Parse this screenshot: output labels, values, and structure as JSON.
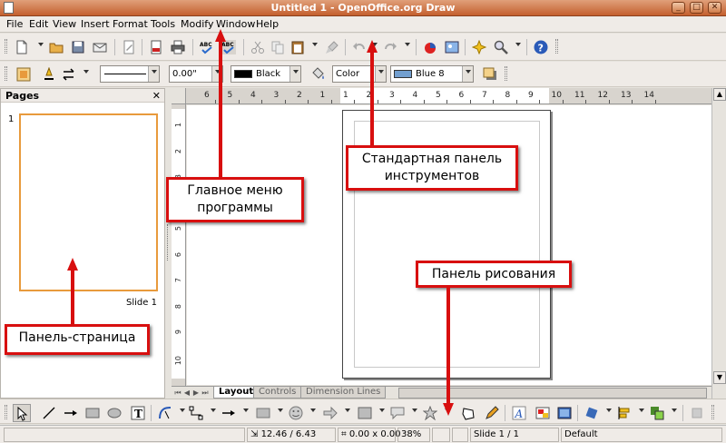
{
  "window": {
    "title": "Untitled 1 - OpenOffice.org Draw"
  },
  "menu": [
    "File",
    "Edit",
    "View",
    "Insert",
    "Format",
    "Tools",
    "Modify",
    "Window",
    "Help"
  ],
  "line_format": {
    "line_width": "0.00\"",
    "line_color": "Black",
    "line_color_hex": "#000000",
    "area_style": "Color",
    "area_color": "Blue 8",
    "area_color_hex": "#729fcf"
  },
  "pages_panel": {
    "title": "Pages",
    "close": "✕",
    "page_number": "1",
    "slide_label": "Slide 1"
  },
  "ruler": {
    "h_labels": [
      "6",
      "5",
      "4",
      "3",
      "2",
      "1",
      "1",
      "2",
      "3",
      "4",
      "5",
      "6",
      "7",
      "8",
      "9",
      "10",
      "11",
      "12",
      "13",
      "14"
    ],
    "v_labels": [
      "1",
      "2",
      "3",
      "4",
      "5",
      "6",
      "7",
      "8",
      "9",
      "10"
    ]
  },
  "layer_tabs": [
    "Layout",
    "Controls",
    "Dimension Lines"
  ],
  "status": {
    "position": "12.46 / 6.43",
    "size": "0.00 x 0.00",
    "zoom": "38%",
    "slide": "Slide 1 / 1",
    "style": "Default"
  },
  "annotations": {
    "main_menu": "Главное меню программы",
    "standard_toolbar": "Стандартная панель инструментов",
    "drawing_toolbar": "Панель рисования",
    "pages_panel": "Панель-страница"
  },
  "colors": {
    "accent": "#d80f0f",
    "title_bar": "#c45f2e",
    "selection": "#e89a3c"
  }
}
